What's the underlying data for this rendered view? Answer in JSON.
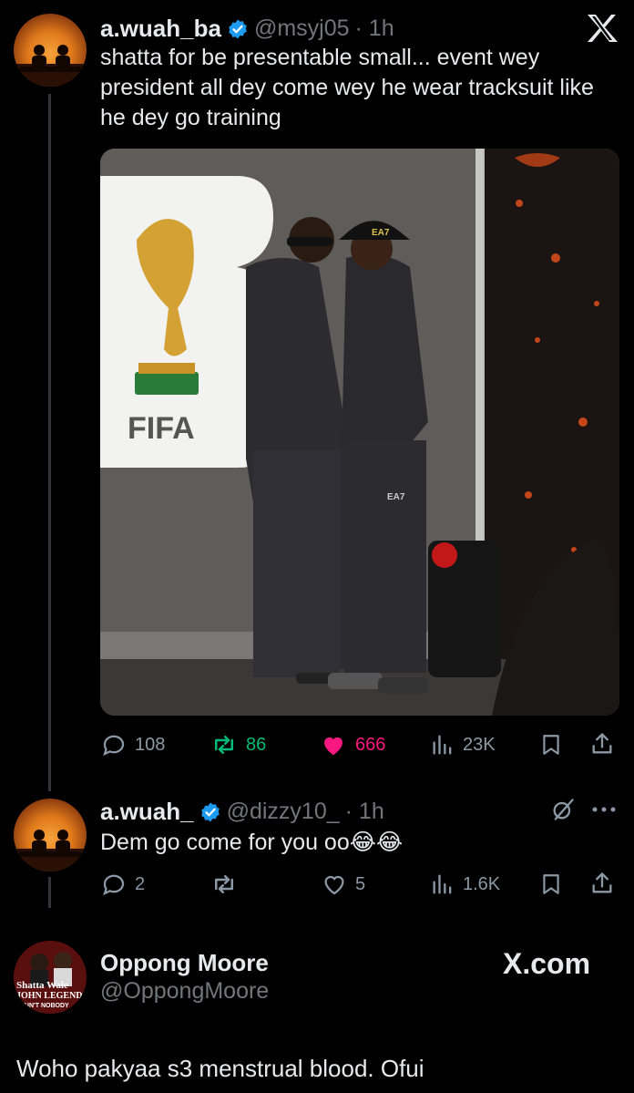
{
  "tweet1": {
    "name": "a.wuah_ba",
    "handle": "@msyj05",
    "time": "· 1h",
    "text": "shatta for be presentable small... event wey president all dey come wey he wear tracksuit like he dey go training",
    "replies": "108",
    "reposts": "86",
    "likes": "666",
    "views": "23K",
    "media": {
      "logo_text": "FIFA",
      "cap_text": "EA7",
      "pants_text": "EA7"
    }
  },
  "tweet2": {
    "name": "a.wuah_",
    "handle": "@dizzy10_",
    "time": "· 1h",
    "text": "Dem go come for you oo😂😂",
    "replies": "2",
    "reposts": "",
    "likes": "5",
    "views": "1.6K"
  },
  "quote_card": {
    "name": "Oppong Moore",
    "handle": "@OppongMoore",
    "site": "X.com",
    "avatar_text_1": "Shatta Wale",
    "avatar_text_2": "JOHN LEGEND",
    "avatar_text_3": "AIN'T NOBODY",
    "text": "Woho pakyaa s3 menstrual blood. Ofui"
  },
  "icons": {
    "x_logo": "x-logo-icon",
    "verified": "verified-badge-icon",
    "reply": "reply-icon",
    "repost": "repost-icon",
    "like": "heart-icon",
    "views": "views-icon",
    "bookmark": "bookmark-icon",
    "share": "share-icon",
    "grok": "grok-icon",
    "more": "more-icon"
  },
  "colors": {
    "background": "#000000",
    "text": "#e7e9ea",
    "muted": "#71767b",
    "verified": "#1d9bf0",
    "repost_green": "#00ba7c",
    "like_pink": "#f91880"
  }
}
